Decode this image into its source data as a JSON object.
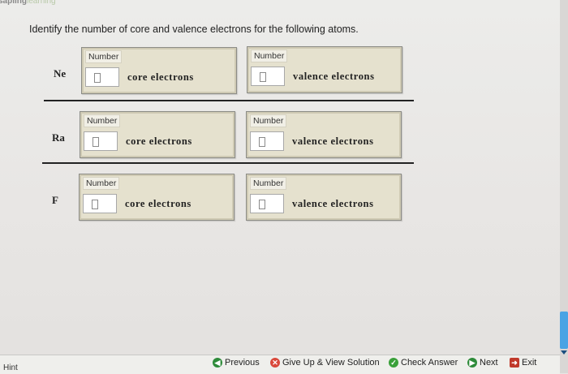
{
  "header": {
    "logo_main": "sapling",
    "logo_sub": "learning"
  },
  "prompt": "Identify the number of core and valence electrons for the following atoms.",
  "rows": [
    {
      "atom": "Ne",
      "core": {
        "label": "Number",
        "value": "",
        "suffix": "core electrons"
      },
      "valence": {
        "label": "Number",
        "value": "",
        "suffix": "valence electrons"
      }
    },
    {
      "atom": "Ra",
      "core": {
        "label": "Number",
        "value": "",
        "suffix": "core electrons"
      },
      "valence": {
        "label": "Number",
        "value": "",
        "suffix": "valence electrons"
      }
    },
    {
      "atom": "F",
      "core": {
        "label": "Number",
        "value": "",
        "suffix": "core electrons"
      },
      "valence": {
        "label": "Number",
        "value": "",
        "suffix": "valence electrons"
      }
    }
  ],
  "footer": {
    "hint": "Hint",
    "previous": "Previous",
    "give_up": "Give Up & View Solution",
    "check": "Check Answer",
    "next": "Next",
    "exit": "Exit"
  },
  "colors": {
    "box_fill": "#e5e1ce",
    "accent_blue": "#4aa3e4",
    "check_green": "#3aa03a",
    "giveup_red": "#d9483b"
  }
}
